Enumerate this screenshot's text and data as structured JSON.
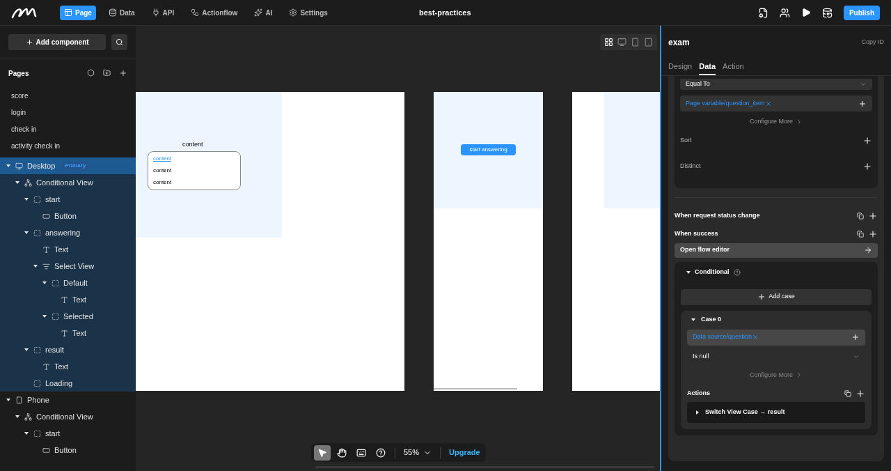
{
  "topbar": {
    "nav": [
      {
        "label": "Page",
        "kind": "page",
        "selected": true
      },
      {
        "label": "Data",
        "kind": "data",
        "selected": false
      },
      {
        "label": "API",
        "kind": "api",
        "selected": false
      },
      {
        "label": "Actionflow",
        "kind": "flow",
        "selected": false
      },
      {
        "label": "AI",
        "kind": "ai",
        "selected": false
      },
      {
        "label": "Settings",
        "kind": "settings",
        "selected": false
      }
    ],
    "title": "best-practices",
    "publish": "Publish"
  },
  "sidebar": {
    "add_component": "Add component",
    "pages_title": "Pages",
    "pages": [
      "score",
      "login",
      "check in",
      "activity check in"
    ],
    "tree": [
      {
        "label": "Desktop",
        "kind": "desktop",
        "badge": "Primary",
        "expanded": true,
        "selected": true,
        "children": [
          {
            "label": "Conditional View",
            "kind": "conditional",
            "expanded": true,
            "children": [
              {
                "label": "start",
                "kind": "container",
                "expanded": true,
                "children": [
                  {
                    "label": "Button",
                    "kind": "button"
                  }
                ]
              },
              {
                "label": "answering",
                "kind": "container",
                "expanded": true,
                "children": [
                  {
                    "label": "Text",
                    "kind": "text"
                  },
                  {
                    "label": "Select View",
                    "kind": "select",
                    "expanded": true,
                    "children": [
                      {
                        "label": "Default",
                        "kind": "container",
                        "expanded": true,
                        "children": [
                          {
                            "label": "Text",
                            "kind": "text"
                          }
                        ]
                      },
                      {
                        "label": "Selected",
                        "kind": "container",
                        "expanded": true,
                        "children": [
                          {
                            "label": "Text",
                            "kind": "text"
                          }
                        ]
                      }
                    ]
                  }
                ]
              },
              {
                "label": "result",
                "kind": "container",
                "expanded": true,
                "children": [
                  {
                    "label": "Text",
                    "kind": "text"
                  }
                ]
              },
              {
                "label": "Loading",
                "kind": "container"
              }
            ]
          }
        ]
      },
      {
        "label": "Phone",
        "kind": "phone",
        "expanded": true,
        "selected": false,
        "children": [
          {
            "label": "Conditional View",
            "kind": "conditional",
            "expanded": true,
            "children": [
              {
                "label": "start",
                "kind": "container",
                "expanded": true,
                "children": [
                  {
                    "label": "Button",
                    "kind": "button"
                  }
                ]
              }
            ]
          }
        ]
      }
    ]
  },
  "canvas": {
    "devices": [
      {
        "kind": "grid",
        "selected": true
      },
      {
        "kind": "desktop",
        "selected": false
      },
      {
        "kind": "phone",
        "selected": false
      },
      {
        "kind": "tablet",
        "selected": false
      }
    ],
    "frame_title": "content",
    "list_items": [
      {
        "label": "content",
        "kind": "link"
      },
      {
        "label": "content",
        "kind": "plain"
      },
      {
        "label": "content",
        "kind": "plain"
      }
    ],
    "start_button": "start answering",
    "tools": [
      {
        "kind": "pointer",
        "selected": true
      },
      {
        "kind": "hand",
        "selected": false
      },
      {
        "kind": "keyboard",
        "selected": false
      },
      {
        "kind": "help",
        "selected": false
      }
    ],
    "zoom": "55%",
    "upgrade": "Upgrade"
  },
  "panel": {
    "title": "exam",
    "copy_id": "Copy ID",
    "tabs": [
      {
        "label": "Design",
        "selected": false
      },
      {
        "label": "Data",
        "selected": true
      },
      {
        "label": "Action",
        "selected": false
      }
    ],
    "operator": "Equal To",
    "filter_value": "Page variable/question_item",
    "configure_more": "Configure More",
    "sort": "Sort",
    "distinct": "Distinct",
    "events": [
      "When request status change",
      "When success"
    ],
    "open_flow": "Open flow editor",
    "conditional": "Conditional",
    "add_case": "Add case",
    "case": {
      "title": "Case 0",
      "value": "Data source/question",
      "operator": "Is null",
      "configure_more": "Configure More",
      "actions": "Actions",
      "action": "Switch View Case → result"
    }
  }
}
